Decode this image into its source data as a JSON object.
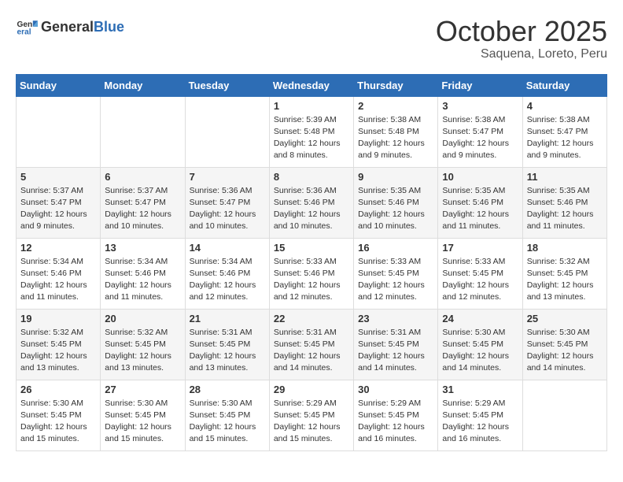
{
  "header": {
    "logo_general": "General",
    "logo_blue": "Blue",
    "month_title": "October 2025",
    "subtitle": "Saquena, Loreto, Peru"
  },
  "days_of_week": [
    "Sunday",
    "Monday",
    "Tuesday",
    "Wednesday",
    "Thursday",
    "Friday",
    "Saturday"
  ],
  "weeks": [
    [
      {
        "day": "",
        "info": ""
      },
      {
        "day": "",
        "info": ""
      },
      {
        "day": "",
        "info": ""
      },
      {
        "day": "1",
        "info": "Sunrise: 5:39 AM\nSunset: 5:48 PM\nDaylight: 12 hours\nand 8 minutes."
      },
      {
        "day": "2",
        "info": "Sunrise: 5:38 AM\nSunset: 5:48 PM\nDaylight: 12 hours\nand 9 minutes."
      },
      {
        "day": "3",
        "info": "Sunrise: 5:38 AM\nSunset: 5:47 PM\nDaylight: 12 hours\nand 9 minutes."
      },
      {
        "day": "4",
        "info": "Sunrise: 5:38 AM\nSunset: 5:47 PM\nDaylight: 12 hours\nand 9 minutes."
      }
    ],
    [
      {
        "day": "5",
        "info": "Sunrise: 5:37 AM\nSunset: 5:47 PM\nDaylight: 12 hours\nand 9 minutes."
      },
      {
        "day": "6",
        "info": "Sunrise: 5:37 AM\nSunset: 5:47 PM\nDaylight: 12 hours\nand 10 minutes."
      },
      {
        "day": "7",
        "info": "Sunrise: 5:36 AM\nSunset: 5:47 PM\nDaylight: 12 hours\nand 10 minutes."
      },
      {
        "day": "8",
        "info": "Sunrise: 5:36 AM\nSunset: 5:46 PM\nDaylight: 12 hours\nand 10 minutes."
      },
      {
        "day": "9",
        "info": "Sunrise: 5:35 AM\nSunset: 5:46 PM\nDaylight: 12 hours\nand 10 minutes."
      },
      {
        "day": "10",
        "info": "Sunrise: 5:35 AM\nSunset: 5:46 PM\nDaylight: 12 hours\nand 11 minutes."
      },
      {
        "day": "11",
        "info": "Sunrise: 5:35 AM\nSunset: 5:46 PM\nDaylight: 12 hours\nand 11 minutes."
      }
    ],
    [
      {
        "day": "12",
        "info": "Sunrise: 5:34 AM\nSunset: 5:46 PM\nDaylight: 12 hours\nand 11 minutes."
      },
      {
        "day": "13",
        "info": "Sunrise: 5:34 AM\nSunset: 5:46 PM\nDaylight: 12 hours\nand 11 minutes."
      },
      {
        "day": "14",
        "info": "Sunrise: 5:34 AM\nSunset: 5:46 PM\nDaylight: 12 hours\nand 12 minutes."
      },
      {
        "day": "15",
        "info": "Sunrise: 5:33 AM\nSunset: 5:46 PM\nDaylight: 12 hours\nand 12 minutes."
      },
      {
        "day": "16",
        "info": "Sunrise: 5:33 AM\nSunset: 5:45 PM\nDaylight: 12 hours\nand 12 minutes."
      },
      {
        "day": "17",
        "info": "Sunrise: 5:33 AM\nSunset: 5:45 PM\nDaylight: 12 hours\nand 12 minutes."
      },
      {
        "day": "18",
        "info": "Sunrise: 5:32 AM\nSunset: 5:45 PM\nDaylight: 12 hours\nand 13 minutes."
      }
    ],
    [
      {
        "day": "19",
        "info": "Sunrise: 5:32 AM\nSunset: 5:45 PM\nDaylight: 12 hours\nand 13 minutes."
      },
      {
        "day": "20",
        "info": "Sunrise: 5:32 AM\nSunset: 5:45 PM\nDaylight: 12 hours\nand 13 minutes."
      },
      {
        "day": "21",
        "info": "Sunrise: 5:31 AM\nSunset: 5:45 PM\nDaylight: 12 hours\nand 13 minutes."
      },
      {
        "day": "22",
        "info": "Sunrise: 5:31 AM\nSunset: 5:45 PM\nDaylight: 12 hours\nand 14 minutes."
      },
      {
        "day": "23",
        "info": "Sunrise: 5:31 AM\nSunset: 5:45 PM\nDaylight: 12 hours\nand 14 minutes."
      },
      {
        "day": "24",
        "info": "Sunrise: 5:30 AM\nSunset: 5:45 PM\nDaylight: 12 hours\nand 14 minutes."
      },
      {
        "day": "25",
        "info": "Sunrise: 5:30 AM\nSunset: 5:45 PM\nDaylight: 12 hours\nand 14 minutes."
      }
    ],
    [
      {
        "day": "26",
        "info": "Sunrise: 5:30 AM\nSunset: 5:45 PM\nDaylight: 12 hours\nand 15 minutes."
      },
      {
        "day": "27",
        "info": "Sunrise: 5:30 AM\nSunset: 5:45 PM\nDaylight: 12 hours\nand 15 minutes."
      },
      {
        "day": "28",
        "info": "Sunrise: 5:30 AM\nSunset: 5:45 PM\nDaylight: 12 hours\nand 15 minutes."
      },
      {
        "day": "29",
        "info": "Sunrise: 5:29 AM\nSunset: 5:45 PM\nDaylight: 12 hours\nand 15 minutes."
      },
      {
        "day": "30",
        "info": "Sunrise: 5:29 AM\nSunset: 5:45 PM\nDaylight: 12 hours\nand 16 minutes."
      },
      {
        "day": "31",
        "info": "Sunrise: 5:29 AM\nSunset: 5:45 PM\nDaylight: 12 hours\nand 16 minutes."
      },
      {
        "day": "",
        "info": ""
      }
    ]
  ]
}
